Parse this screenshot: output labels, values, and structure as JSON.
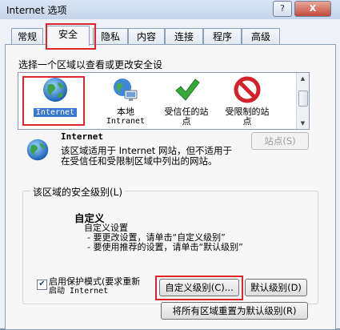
{
  "window": {
    "title": "Internet 选项",
    "help_label": "?",
    "close_label": "X"
  },
  "tabs": [
    {
      "label": "常规"
    },
    {
      "label": "安全",
      "active": true
    },
    {
      "label": "隐私"
    },
    {
      "label": "内容"
    },
    {
      "label": "连接"
    },
    {
      "label": "程序"
    },
    {
      "label": "高级"
    }
  ],
  "security": {
    "zones_label": "选择一个区域以查看或更改安全设",
    "zones": [
      {
        "label_line1": "Internet",
        "label_line2": "",
        "icon": "globe-icon",
        "selected": true
      },
      {
        "label_line1": "本地",
        "label_line2": "Intranet",
        "icon": "local-intranet-icon"
      },
      {
        "label_line1": "受信任的站",
        "label_line2": "点",
        "icon": "checkmark-icon"
      },
      {
        "label_line1": "受限制的站",
        "label_line2": "点",
        "icon": "restricted-icon"
      }
    ],
    "selected_zone_name": "Internet",
    "selected_zone_desc_line1": "该区域适用于 Internet 网站，但不适用于",
    "selected_zone_desc_line2": "在受信任和受限制区域中列出的网站。",
    "sites_button": "站点(S)",
    "level_group_label": "该区域的安全级别(L)",
    "level_title": "自定义",
    "level_lines": [
      "自定义设置",
      "- 要更改设置，请单击“自定义级别”",
      "- 要使用推荐的设置，请单击“默认级别”"
    ],
    "protected_mode_line1": "启用保护模式(要求重新",
    "protected_mode_line2": "启动 Internet",
    "protected_mode_checked": true,
    "custom_level_button": "自定义级别(C)...",
    "default_level_button": "默认级别(D)",
    "reset_all_button": "将所有区域重置为默认级别(R)"
  },
  "colors": {
    "highlight_box": "#e0242b",
    "selection": "#3a79d1"
  }
}
